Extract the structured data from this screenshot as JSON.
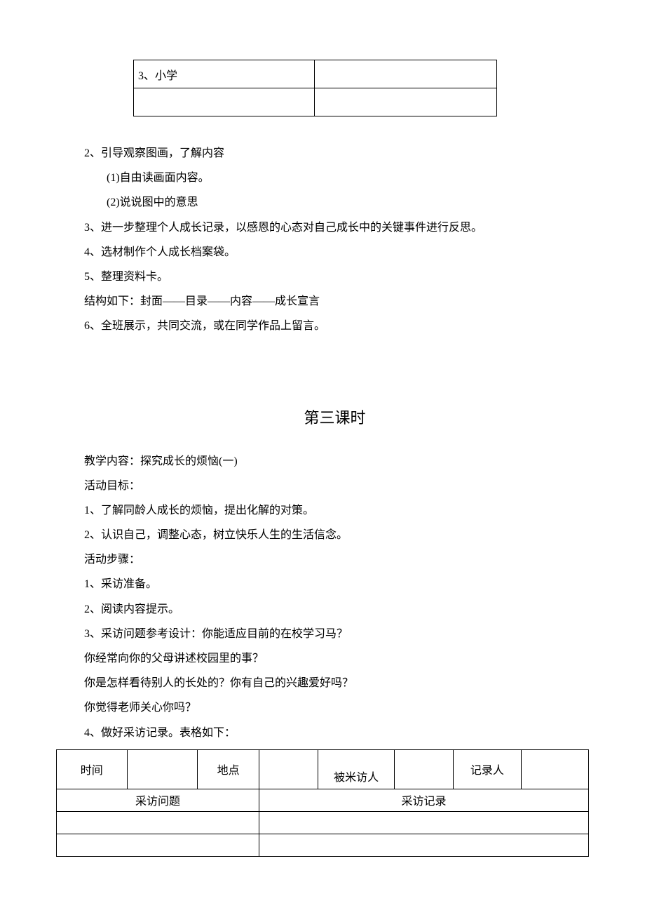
{
  "table1": {
    "row1_col1": "3、小学",
    "row1_col2": "",
    "row2_col1": "",
    "row2_col2": ""
  },
  "body_lines": {
    "l1": "2、引导观察图画，了解内容",
    "l2": "(1)自由读画面内容。",
    "l3": "(2)说说图中的意思",
    "l4": "3、进一步整理个人成长记录，以感恩的心态对自己成长中的关键事件进行反思。",
    "l5": "4、选材制作个人成长档案袋。",
    "l6": "5、整理资料卡。",
    "l7": "结构如下：封面——目录——内容——成长宣言",
    "l8": "6、全班展示，共同交流，或在同学作品上留言。"
  },
  "section_title": "第三课时",
  "lesson": {
    "p1": "教学内容：探究成长的烦恼(一)",
    "p2": "活动目标：",
    "p3": "1、了解同龄人成长的烦恼，提出化解的对策。",
    "p4": "2、认识自己，调整心态，树立快乐人生的生活信念。",
    "p5": "活动步骤：",
    "p6": "1、采访准备。",
    "p7": "2、阅读内容提示。",
    "p8": "3、采访问题参考设计：你能适应目前的在校学习马？",
    "p9": "你经常向你的父母讲述校园里的事？",
    "p10": "你是怎样看待别人的长处的？你有自己的兴趣爱好吗？",
    "p11": "你觉得老师关心你吗？",
    "p12": "4、做好采访记录。表格如下："
  },
  "table2": {
    "h1": "时间",
    "h2": "",
    "h3": "地点",
    "h4": "",
    "h5": "被米访人",
    "h6": "",
    "h7": "记录人",
    "h8": "",
    "sub_left": "采访问题",
    "sub_right": "采访记录"
  }
}
